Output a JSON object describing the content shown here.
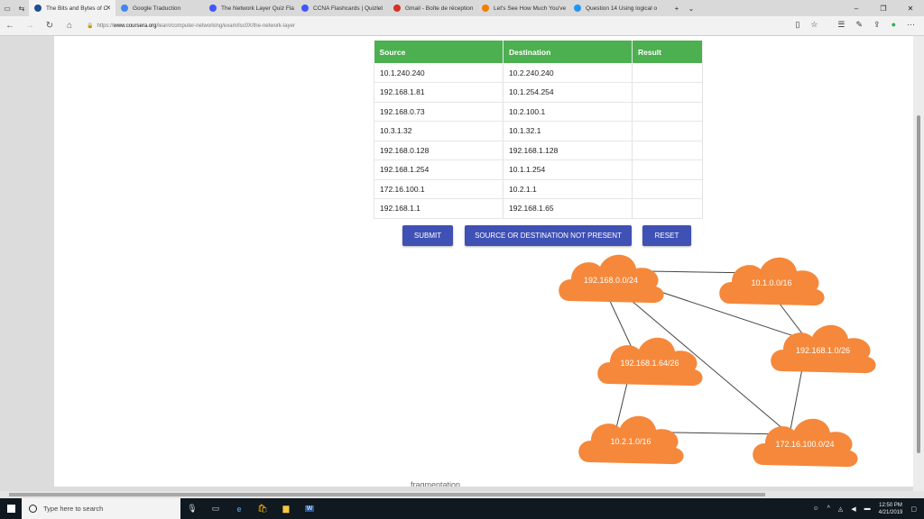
{
  "tabs": [
    {
      "title": "The Bits and Bytes of C",
      "icon_color": "#1f4e91",
      "active": true
    },
    {
      "title": "Google Traduction",
      "icon_color": "#4285f4"
    },
    {
      "title": "The Network Layer Quiz Fla",
      "icon_color": "#4255ff"
    },
    {
      "title": "CCNA Flashcards | Quizlet",
      "icon_color": "#4255ff"
    },
    {
      "title": "Gmail - Boîte de réception",
      "icon_color": "#d93025"
    },
    {
      "title": "Let's See How Much You've",
      "icon_color": "#f57c00"
    },
    {
      "title": "Question 14 Using logical o",
      "icon_color": "#2196f3"
    }
  ],
  "address": {
    "url_prefix": "https://",
    "url_host": "www.coursera.org",
    "url_path": "/learn/computer-networking/exam/lsc0X/the-network-layer"
  },
  "table": {
    "headers": {
      "source": "Source",
      "destination": "Destination",
      "result": "Result"
    },
    "rows": [
      {
        "source": "10.1.240.240",
        "destination": "10.2.240.240",
        "result": ""
      },
      {
        "source": "192.168.1.81",
        "destination": "10.1.254.254",
        "result": ""
      },
      {
        "source": "192.168.0.73",
        "destination": "10.2.100.1",
        "result": ""
      },
      {
        "source": "10.3.1.32",
        "destination": "10.1.32.1",
        "result": ""
      },
      {
        "source": "192.168.0.128",
        "destination": "192.168.1.128",
        "result": ""
      },
      {
        "source": "192.168.1.254",
        "destination": "10.1.1.254",
        "result": ""
      },
      {
        "source": "172.16.100.1",
        "destination": "10.2.1.1",
        "result": ""
      },
      {
        "source": "192.168.1.1",
        "destination": "192.168.1.65",
        "result": ""
      }
    ]
  },
  "buttons": {
    "submit": "SUBMIT",
    "source_or_destination": "SOURCE OR DESTINATION NOT PRESENT",
    "reset": "RESET"
  },
  "network": {
    "cloud_color": "#f5883a",
    "nodes": [
      {
        "id": "n192_168_0",
        "label": "192.168.0.0/24"
      },
      {
        "id": "n10_1",
        "label": "10.1.0.0/16"
      },
      {
        "id": "n192_168_1_0",
        "label": "192.168.1.0/26"
      },
      {
        "id": "n192_168_1_64",
        "label": "192.168.1.64/26"
      },
      {
        "id": "n10_2_1",
        "label": "10.2.1.0/16"
      },
      {
        "id": "n172_16",
        "label": "172.16.100.0/24"
      }
    ],
    "links": [
      [
        "n192_168_0",
        "n10_1"
      ],
      [
        "n192_168_0",
        "n192_168_1_0"
      ],
      [
        "n192_168_0",
        "n192_168_1_64"
      ],
      [
        "n192_168_0",
        "n172_16"
      ],
      [
        "n10_1",
        "n192_168_1_0"
      ],
      [
        "n192_168_1_64",
        "n10_2_1"
      ],
      [
        "n10_2_1",
        "n172_16"
      ],
      [
        "n192_168_1_0",
        "n172_16"
      ]
    ]
  },
  "below_fold_text": "fragmentation",
  "taskbar": {
    "search_placeholder": "Type here to search",
    "time": "12:50 PM",
    "date": "4/21/2019"
  }
}
